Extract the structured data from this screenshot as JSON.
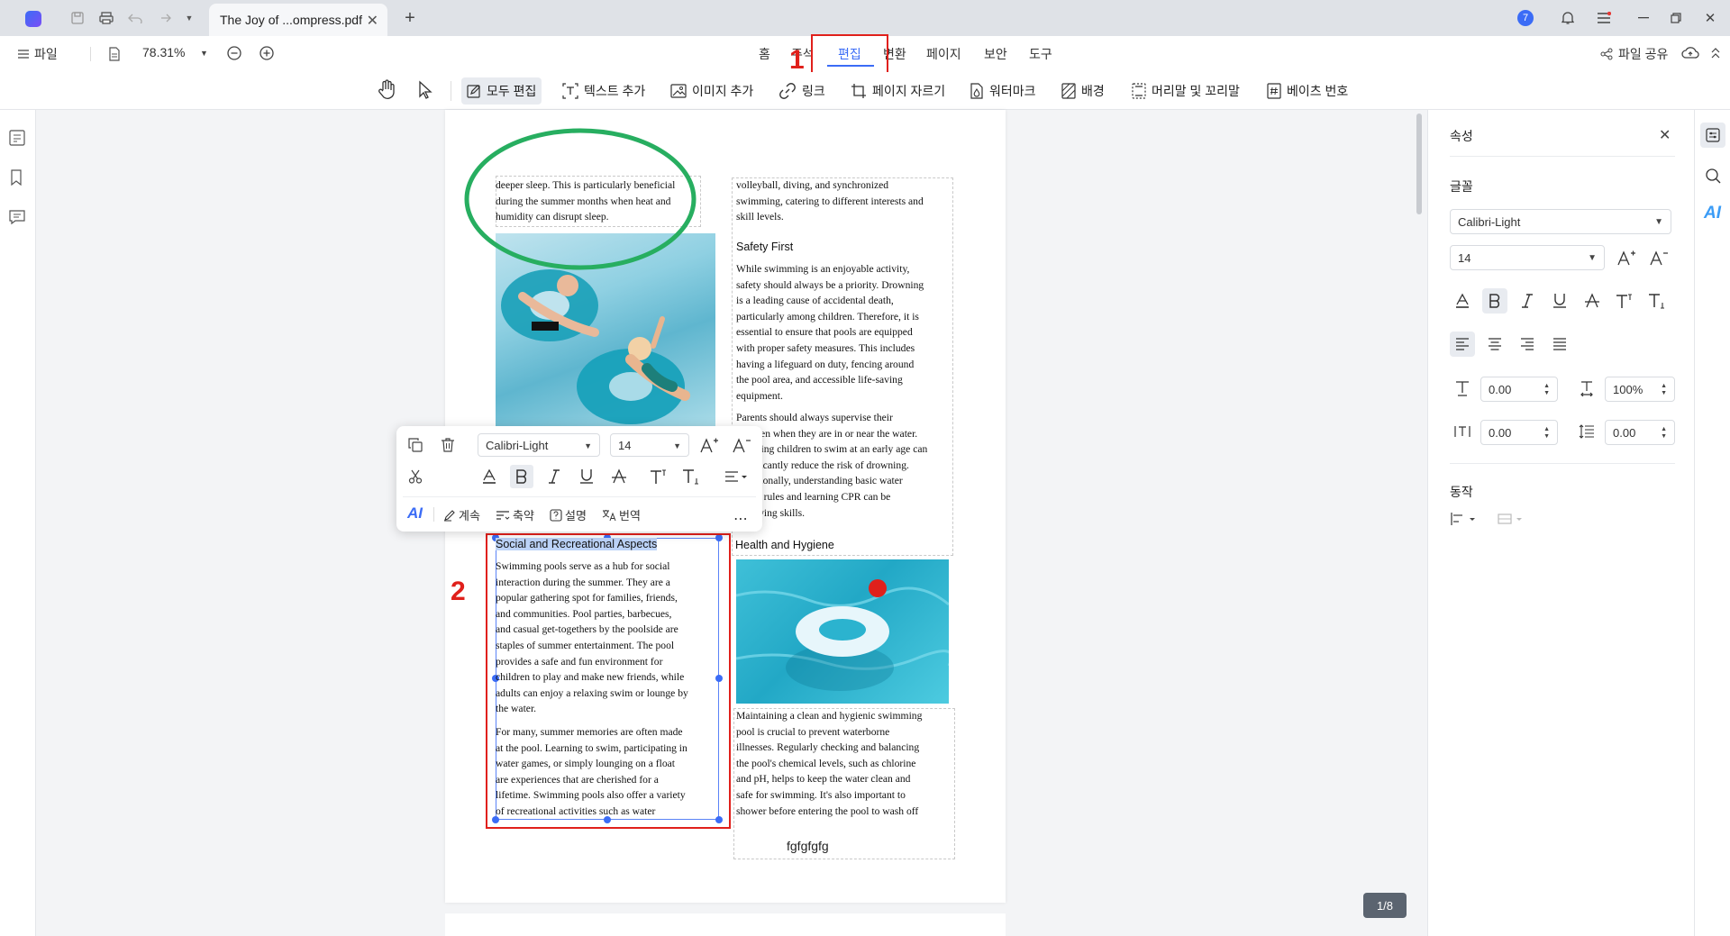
{
  "titlebar": {
    "tab_title": "The Joy of ...ompress.pdf",
    "notification_count": "7"
  },
  "menubar": {
    "file_label": "파일",
    "zoom": "78.31%",
    "tabs": [
      "홈",
      "주석",
      "편집",
      "변환",
      "페이지",
      "보안",
      "도구"
    ],
    "active_tab": "편집",
    "share_label": "파일 공유"
  },
  "toolbar": {
    "items": [
      "모두 편집",
      "텍스트 추가",
      "이미지 추가",
      "링크",
      "페이지 자르기",
      "워터마크",
      "배경",
      "머리말 및 꼬리말",
      "베이츠 번호"
    ]
  },
  "annotations": {
    "marker1": "1",
    "marker2": "2",
    "colors": {
      "red": "#e0201b",
      "green": "#27ae60"
    }
  },
  "page": {
    "col1_top": [
      "deeper sleep. This is particularly beneficial",
      "during the summer months when heat and",
      "humidity can disrupt sleep."
    ],
    "col2_top": [
      "volleyball, diving, and synchronized",
      "swimming, catering to different interests and",
      "skill levels."
    ],
    "safety_heading": "Safety First",
    "safety_p1": [
      "While swimming is an enjoyable activity,",
      "safety should always be a priority. Drowning",
      "is a leading cause of accidental death,",
      "particularly among children. Therefore, it is",
      "essential to ensure that pools are equipped",
      "with proper safety measures. This includes",
      "having a lifeguard on duty, fencing around",
      "the pool area, and accessible life-saving",
      "equipment."
    ],
    "safety_p2": [
      "Parents should always supervise their",
      "children when they are in or near the water.",
      "Teaching children to swim at an early age can",
      "significantly reduce the risk of drowning.",
      "Additionally, understanding basic water",
      "safety rules and learning CPR can be",
      "lifesaving skills."
    ],
    "social_heading": "Social and Recreational Aspects",
    "social_p1": [
      "Swimming pools serve as a hub for social",
      "interaction during the summer. They are a",
      "popular gathering spot for families, friends,",
      "and communities. Pool parties, barbecues,",
      "and casual get-togethers by the poolside are",
      "staples of summer entertainment. The pool",
      "provides a safe and fun environment for",
      "children to play and make new friends, while",
      "adults can enjoy a relaxing swim or lounge by",
      "the water."
    ],
    "social_p2": [
      "For many, summer memories are often made",
      "at the pool. Learning to swim, participating in",
      "water games, or simply lounging on a float",
      "are experiences that are cherished for a",
      "lifetime. Swimming pools also offer a variety",
      "of recreational activities such as water"
    ],
    "health_heading": "Health and Hygiene",
    "health_p": [
      "Maintaining a clean and hygienic swimming",
      "pool is crucial to prevent waterborne",
      "illnesses. Regularly checking and balancing",
      "the pool's chemical levels, such as chlorine",
      "and pH, helps to keep the water clean and",
      "safe for swimming. It's also important to",
      "shower before entering the pool to wash off"
    ],
    "footer_text": "fgfgfgfg",
    "page_indicator": "1/8"
  },
  "format_toolbar": {
    "font": "Calibri-Light",
    "size": "14",
    "ai_label": "AI",
    "actions": [
      "계속",
      "축약",
      "설명",
      "번역"
    ]
  },
  "properties": {
    "title": "속성",
    "font_section": "글꼴",
    "font": "Calibri-Light",
    "size": "14",
    "char_spacing": "0.00",
    "scale": "100%",
    "para_spacing": "0.00",
    "line_spacing": "0.00",
    "action_section": "동작"
  }
}
